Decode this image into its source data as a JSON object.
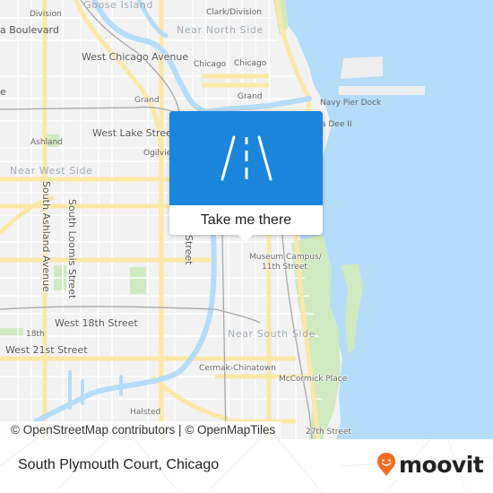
{
  "map": {
    "colors": {
      "land": "#f2f2f3",
      "water": "#b5dcf9",
      "park": "#cfeac0",
      "major_road": "#fbe8a6",
      "minor_road": "#ffffff",
      "rail": "#a8a8a8",
      "building": "#e9e2e2"
    },
    "labels": {
      "goose_island": "Goose Island",
      "division": "Division",
      "clark_division": "Clark/Division",
      "boulevard": "a Boulevard",
      "near_north_side": "Near North Side",
      "west_chicago_avenue": "West Chicago Avenue",
      "chicago_1": "Chicago",
      "chicago_2": "Chicago",
      "grand_1": "Grand",
      "grand_2": "Grand",
      "navy_pier_dock": "Navy Pier Dock",
      "dee_ii": "a Dee II",
      "ashland": "Ashland",
      "west_lake_street": "West Lake Street",
      "ogilvie": "Ogilvie",
      "near_west_side": "Near West Side",
      "south_ashland_avenue": "South Ashland Avenue",
      "south_loomis_street": "South Loomis Street",
      "street_partial": "Street",
      "museum_campus_1": "Museum Campus/",
      "museum_campus_2": "11th Street",
      "west_18th_street": "West 18th Street",
      "eighteenth": "18th",
      "west_21st_street": "West 21st Street",
      "near_south_side": "Near South Side",
      "cermak_chinatown": "Cermak-Chinatown",
      "mccormick_place": "McCormick Place",
      "halsted": "Halsted",
      "twenty_seventh_street": "27th Street",
      "edge_e": "e"
    }
  },
  "popup": {
    "icon": "road-icon",
    "action_label": "Take me there",
    "color": "#1b85dc"
  },
  "attribution": {
    "osm": "© OpenStreetMap contributors",
    "separator": " | ",
    "omt": "© OpenMapTiles"
  },
  "footer": {
    "place_name": "South Plymouth Court, Chicago",
    "brand": "moovit",
    "brand_icon": "moovit-pin-icon",
    "brand_color": "#f26c21"
  }
}
